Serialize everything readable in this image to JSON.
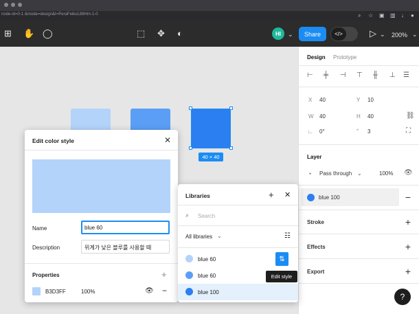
{
  "browser": {
    "url": "node-id=0-1 &mode=design&t=PeraFeikuL88Hm-1-0"
  },
  "toolbar": {
    "avatar_initials": "HI",
    "share_label": "Share",
    "zoom_label": "200%",
    "icons": [
      "frame-icon",
      "hand-icon",
      "comment-icon",
      "crop-icon",
      "component-icon",
      "contrast-icon",
      "code-icon",
      "play-icon"
    ]
  },
  "canvas": {
    "swatch_colors": [
      "#b3d3fa",
      "#5b9ef5",
      "#2b7ff0"
    ],
    "size_label": "40 × 40"
  },
  "design_panel": {
    "tabs": [
      "Design",
      "Prototype"
    ],
    "x_label": "X",
    "x_value": "40",
    "y_label": "Y",
    "y_value": "10",
    "w_label": "W",
    "w_value": "40",
    "h_label": "H",
    "h_value": "40",
    "rotation_value": "0°",
    "radius_value": "3",
    "layer_title": "Layer",
    "blend_mode": "Pass through",
    "layer_opacity": "100%",
    "fill_style_name": "blue 100",
    "fill_style_color": "#2b7ff0",
    "stroke_label": "Stroke",
    "effects_label": "Effects",
    "export_label": "Export",
    "help_label": "?"
  },
  "edit_dialog": {
    "title": "Edit color style",
    "preview_color": "#b3d3fa",
    "name_label": "Name",
    "name_value": "blue 60",
    "description_label": "Description",
    "description_value": "위계가 낮은 블루를 사용할 때",
    "properties_title": "Properties",
    "hex_value": "B3D3FF",
    "opacity_value": "100%"
  },
  "libraries": {
    "title": "Libraries",
    "search_placeholder": "Search",
    "filter_label": "All libraries",
    "items": [
      {
        "name": "blue 60",
        "color": "#b3d3fa"
      },
      {
        "name": "blue 60",
        "color": "#5b9ef5"
      },
      {
        "name": "blue 100",
        "color": "#2b7ff0"
      }
    ],
    "tooltip": "Edit style"
  }
}
